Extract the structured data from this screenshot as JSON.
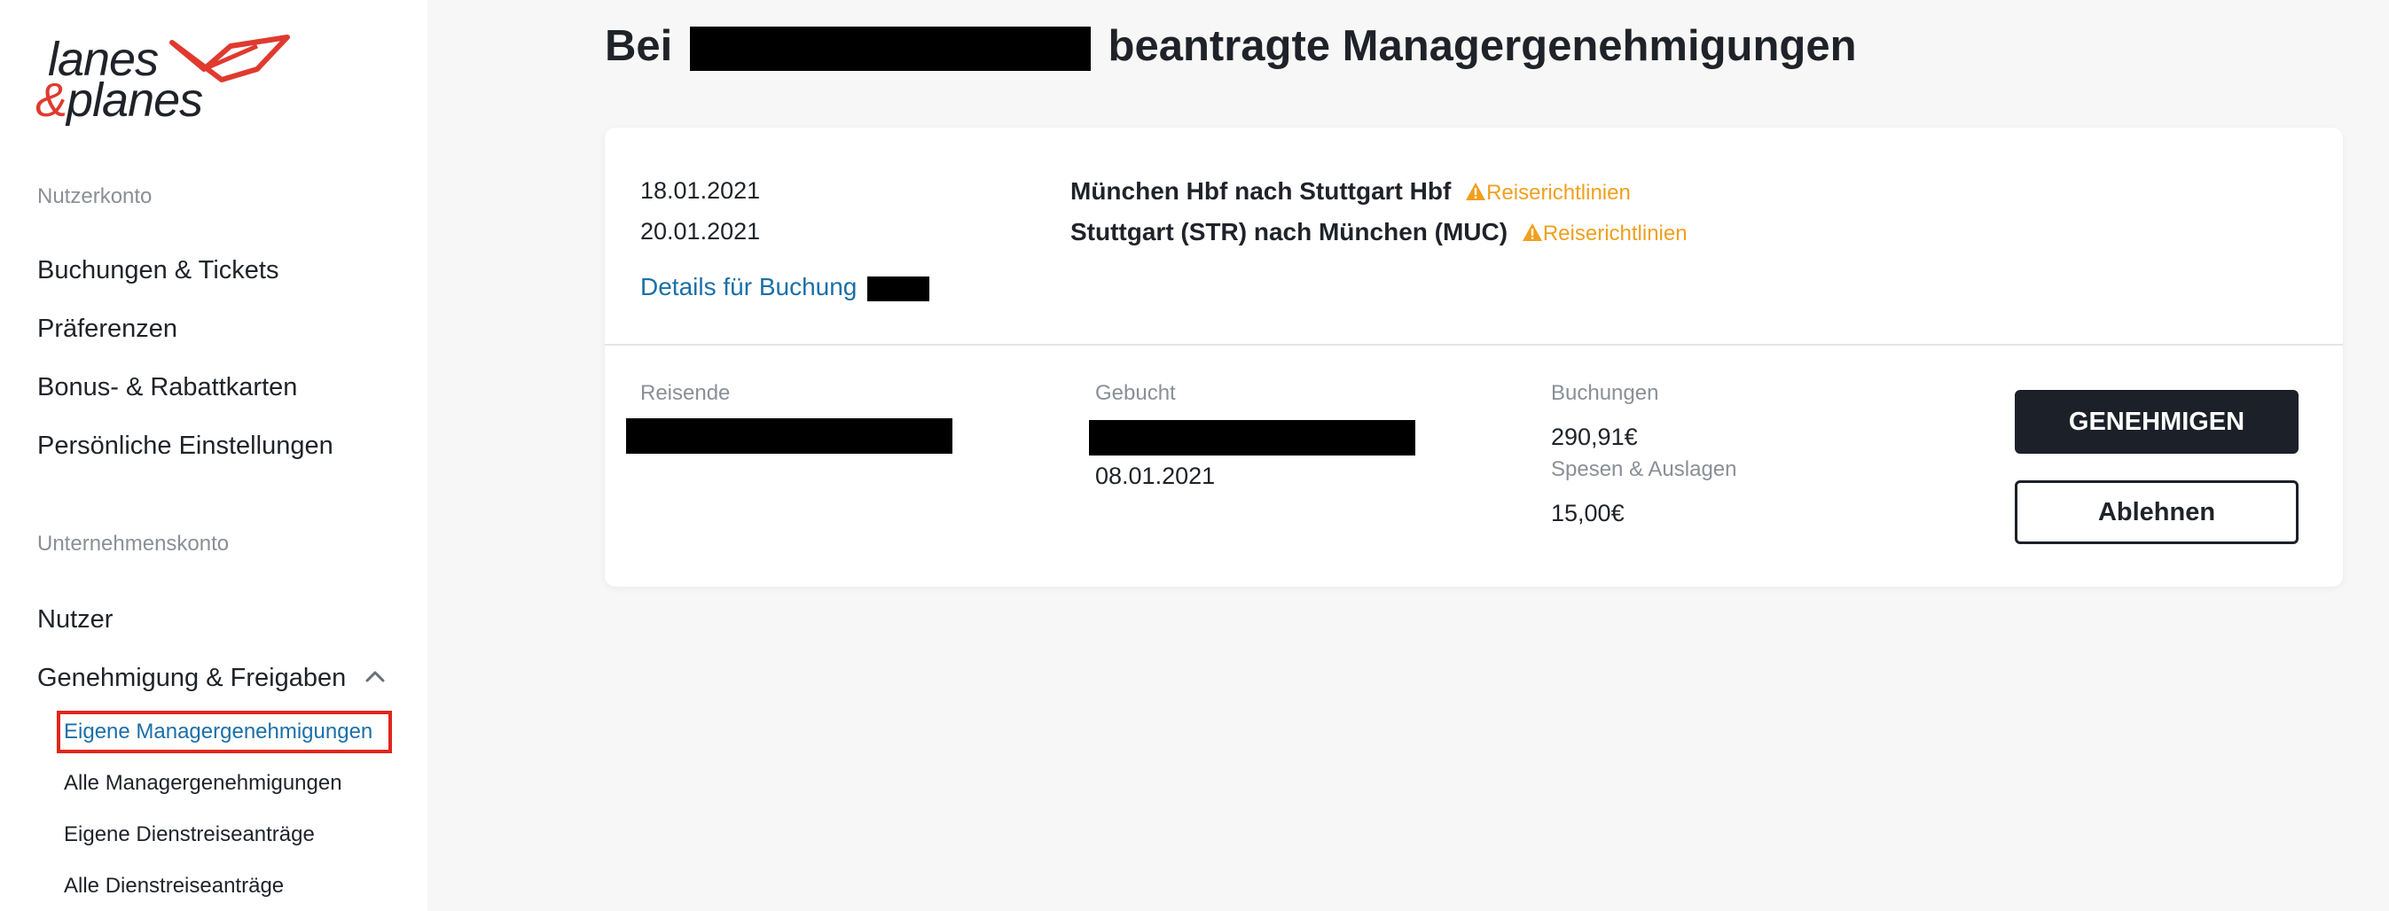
{
  "brand": {
    "line1": "lanes",
    "amp": "&",
    "line2": "planes",
    "accent": "#e03a2f"
  },
  "sidebar": {
    "user_section": "Nutzerkonto",
    "user_items": [
      {
        "label": "Buchungen & Tickets"
      },
      {
        "label": "Präferenzen"
      },
      {
        "label": "Bonus- & Rabattkarten"
      },
      {
        "label": "Persönliche Einstellungen"
      }
    ],
    "company_section": "Unternehmenskonto",
    "company_items": [
      {
        "label": "Nutzer"
      },
      {
        "label": "Genehmigung & Freigaben",
        "icon": "chevron-up-icon"
      }
    ],
    "sub_items": [
      {
        "label": "Eigene Managergenehmigungen",
        "active": true
      },
      {
        "label": "Alle Managergenehmigungen"
      },
      {
        "label": "Eigene Dienstreiseanträge"
      },
      {
        "label": "Alle Dienstreiseanträge"
      }
    ]
  },
  "page": {
    "title_prefix": "Bei",
    "title_suffix": "beantragte Managergenehmigungen"
  },
  "booking": {
    "trips": [
      {
        "date": "18.01.2021",
        "route": "München Hbf nach Stuttgart Hbf",
        "warning": "Reiserichtlinien"
      },
      {
        "date": "20.01.2021",
        "route": "Stuttgart (STR) nach München (MUC)",
        "warning": "Reiserichtlinien"
      }
    ],
    "details_link": "Details für Buchung",
    "travelers_label": "Reisende",
    "booked_label": "Gebucht",
    "booked_date": "08.01.2021",
    "bookings_label": "Buchungen",
    "bookings_amount": "290,91€",
    "expenses_label": "Spesen & Auslagen",
    "expenses_amount": "15,00€",
    "approve_button": "GENEHMIGEN",
    "reject_button": "Ablehnen",
    "warning_color": "#f0a01e",
    "link_color": "#1b6fa8"
  }
}
